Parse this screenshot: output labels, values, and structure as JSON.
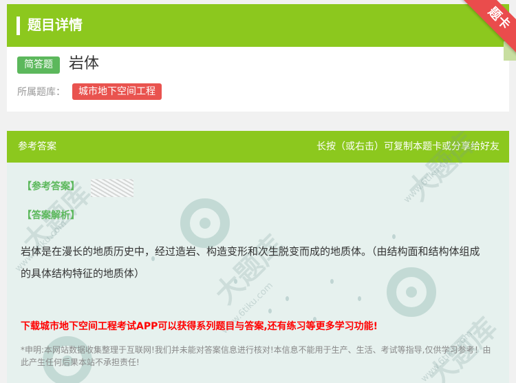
{
  "header": {
    "title": "题目详情",
    "ribbon": "题卡"
  },
  "question": {
    "type_badge": "简答题",
    "title": "岩体",
    "bank_label": "所属题库：",
    "bank_name": "城市地下空间工程"
  },
  "answer": {
    "header_left": "参考答案",
    "header_right": "长按（或右击）可复制本题卡或分享给好友",
    "ref_label": "【参考答案】",
    "analysis_label": "【答案解析】",
    "analysis_text": "岩体是在漫长的地质历史中，经过造岩、构造变形和次生脱变而成的地质体。（由结构面和结构体组成的具体结构特征的地质体）",
    "promo": "下载城市地下空间工程考试APP可以获得系列题目与答案,还有练习等更多学习功能!",
    "disclaimer": "*申明:本网站数据收集整理于互联网!我们并未能对答案信息进行核对!本信息不能用于生产、生活、考试等指导,仅供学习参考！由此产生任何后果本站不承担责任!"
  },
  "watermark": {
    "brand": "大题库",
    "site": "www.6tiku.com"
  },
  "colors": {
    "green": "#8cc81e",
    "red": "#e9534f",
    "badge_green": "#5cb85c",
    "promo_red": "#ff0000"
  }
}
